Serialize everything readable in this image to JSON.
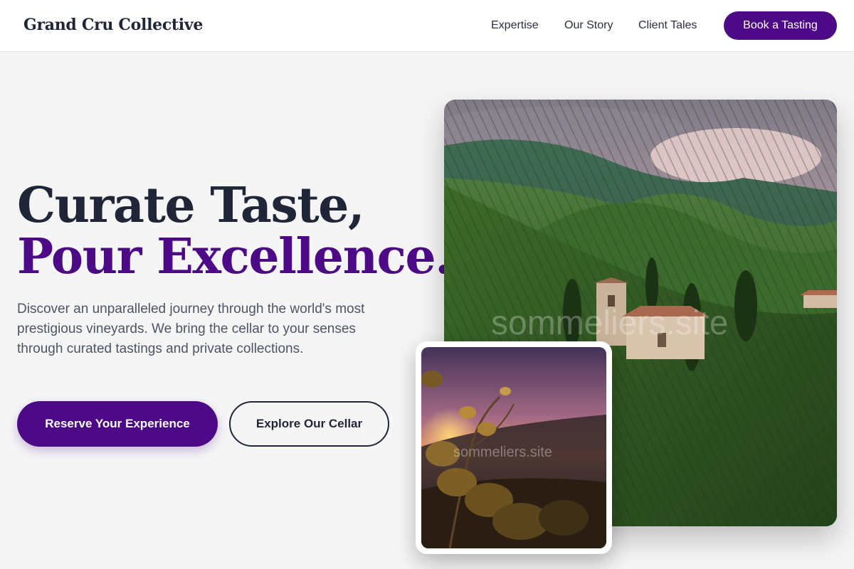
{
  "header": {
    "brand": "Grand Cru Collective",
    "nav": [
      "Expertise",
      "Our Story",
      "Client Tales"
    ],
    "cta": "Book a Tasting"
  },
  "hero": {
    "headline_line1": "Curate Taste,",
    "headline_line2": "Pour Excellence.",
    "description": "Discover an unparalleled journey through the world's most prestigious vineyards. We bring the cellar to your senses through curated tastings and private collections.",
    "primary_button": "Reserve Your Experience",
    "secondary_button": "Explore Our Cellar"
  },
  "images": {
    "main_watermark": "sommeliers.site",
    "inset_watermark": "sommeliers.site"
  },
  "colors": {
    "brand_purple": "#4d0a86",
    "ink": "#1e2638",
    "background": "#f5f5f6"
  }
}
